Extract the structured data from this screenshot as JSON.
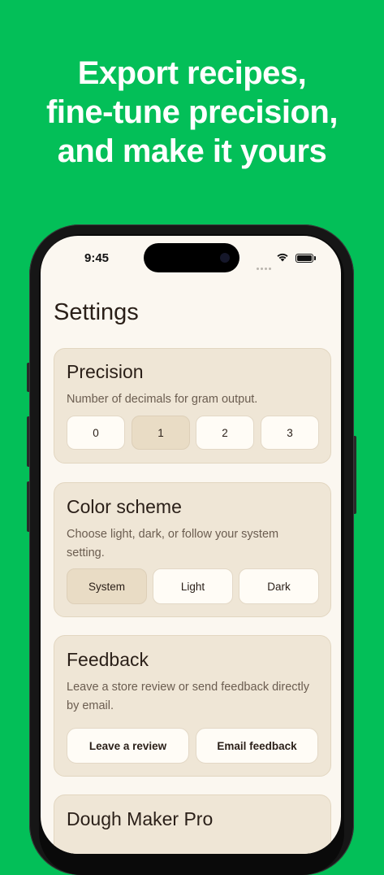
{
  "headline": {
    "line1": "Export recipes,",
    "line2": "fine-tune precision,",
    "line3": "and make it yours"
  },
  "status_bar": {
    "time": "9:45"
  },
  "settings": {
    "title": "Settings",
    "precision": {
      "title": "Precision",
      "description": "Number of decimals for gram output.",
      "options": [
        "0",
        "1",
        "2",
        "3"
      ],
      "selected": "1"
    },
    "color_scheme": {
      "title": "Color scheme",
      "description": "Choose light, dark, or follow your system setting.",
      "options": [
        "System",
        "Light",
        "Dark"
      ],
      "selected": "System"
    },
    "feedback": {
      "title": "Feedback",
      "description": "Leave a store review or send feedback directly by email.",
      "review_label": "Leave a review",
      "email_label": "Email feedback"
    },
    "pro": {
      "title": "Dough Maker Pro"
    }
  },
  "colors": {
    "background": "#03bf58",
    "screen": "#fbf7f0",
    "card": "#efe6d6",
    "selected_segment": "#e9dcc5",
    "text": "#2a1f18"
  },
  "icons": [
    "wifi-icon",
    "battery-icon",
    "signal-dots-icon"
  ]
}
